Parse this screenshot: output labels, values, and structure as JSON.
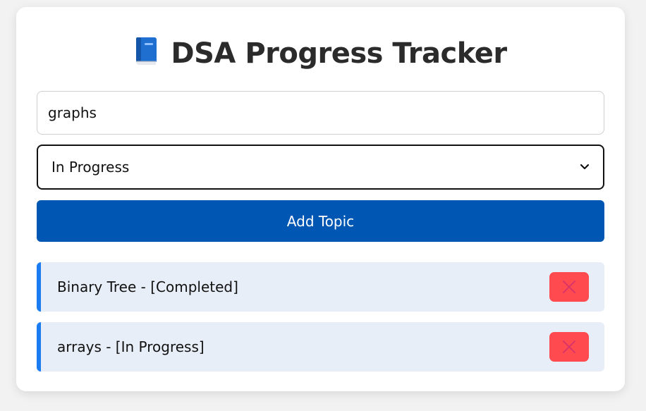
{
  "header": {
    "title": "DSA Progress Tracker",
    "icon": "blue-book-icon"
  },
  "form": {
    "topic_input_value": "graphs",
    "status_select": {
      "selected": "In Progress",
      "icon": "chevron-down-icon"
    },
    "add_button_label": "Add Topic"
  },
  "topics": [
    {
      "label": "Binary Tree - [Completed]",
      "delete_icon": "close-icon"
    },
    {
      "label": "arrays - [In Progress]",
      "delete_icon": "close-icon"
    }
  ],
  "colors": {
    "primary_button": "#0057b3",
    "item_background": "#e8eef8",
    "item_accent": "#1a7cf0",
    "delete_button": "#ff4a4f",
    "delete_icon": "#d6336c"
  }
}
